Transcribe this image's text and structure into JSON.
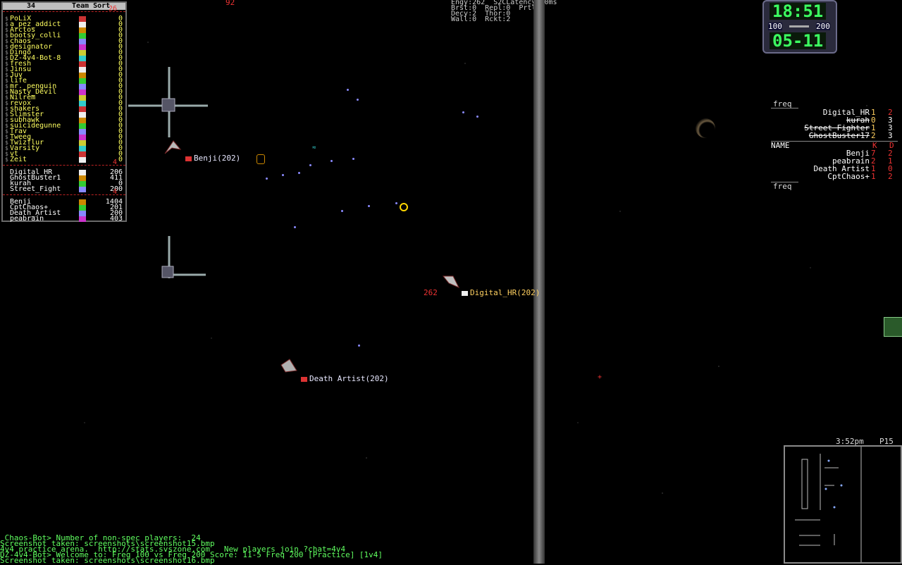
{
  "roster": {
    "count": "34",
    "title": "Team Sort",
    "groups": [
      {
        "count": "26",
        "players": [
          {
            "name": "PoLiX",
            "score": "0"
          },
          {
            "name": "a_pez_addict",
            "score": "0"
          },
          {
            "name": "Arctos",
            "score": "0"
          },
          {
            "name": "bootsy_colli",
            "score": "0"
          },
          {
            "name": "chaos",
            "score": "0"
          },
          {
            "name": "designator",
            "score": "0"
          },
          {
            "name": "Dingo",
            "score": "0"
          },
          {
            "name": "DZ-4v4-Bot-8",
            "score": "0"
          },
          {
            "name": "fresh",
            "score": "0"
          },
          {
            "name": "Jinsu",
            "score": "0"
          },
          {
            "name": "Juv",
            "score": "0"
          },
          {
            "name": "life",
            "score": "0"
          },
          {
            "name": "mr._penguin",
            "score": "0"
          },
          {
            "name": "Nasty_Devil",
            "score": "0"
          },
          {
            "name": "Nilrem",
            "score": "0"
          },
          {
            "name": "revox",
            "score": "0"
          },
          {
            "name": "shakers",
            "score": "0"
          },
          {
            "name": "Slimster",
            "score": "0"
          },
          {
            "name": "subhawk",
            "score": "0"
          },
          {
            "name": "suicidegunne",
            "score": "0"
          },
          {
            "name": "Trav",
            "score": "0"
          },
          {
            "name": "Tweeg",
            "score": "0"
          },
          {
            "name": "Twizflur",
            "score": "0"
          },
          {
            "name": "Varsity",
            "score": "0"
          },
          {
            "name": "vt",
            "score": "0"
          },
          {
            "name": "Zeit",
            "score": "0"
          }
        ]
      },
      {
        "count": "4",
        "players": [
          {
            "name": "Digital_HR",
            "score": "206"
          },
          {
            "name": "GhostBuster1",
            "score": "411"
          },
          {
            "name": "kurah",
            "score": "0"
          },
          {
            "name": "Street_Fight",
            "score": "200"
          }
        ]
      },
      {
        "count": "4",
        "players": [
          {
            "name": "Benji",
            "score": "1404"
          },
          {
            "name": "CptChaos+",
            "score": "201"
          },
          {
            "name": "Death_Artist",
            "score": "200"
          },
          {
            "name": "peabrain",
            "score": "403"
          }
        ]
      }
    ]
  },
  "hud": {
    "energy_indicator": "92",
    "stats_line1": "Engy:262  S2CLatency:80ms",
    "stats_line2": "Brst:0  Repl:0  Prtl:2",
    "stats_line3": "Decy:2  Thor:0",
    "stats_line4": "Wall:0  Rckt:2",
    "clock_top": "18:51",
    "freq_left": "100",
    "freq_right": "200",
    "clock_bottom": "05-11",
    "time": "3:52pm",
    "page": "P15"
  },
  "ships": [
    {
      "label": "Benji(202)"
    },
    {
      "label": "Digital_HR(202)",
      "energy": "262"
    },
    {
      "label": "Death Artist(202)"
    }
  ],
  "freq_table": {
    "header": "freq",
    "rows": [
      {
        "name": "Digital_HR",
        "k": "1",
        "d": "2"
      },
      {
        "name": "kurah",
        "k": "0",
        "d": "3"
      },
      {
        "name": "Street Fighter",
        "k": "1",
        "d": "3"
      },
      {
        "name": "GhostBuster17",
        "k": "2",
        "d": "3"
      }
    ]
  },
  "name_table": {
    "col_name": "NAME",
    "col_k": "K",
    "col_d": "D",
    "rows": [
      {
        "name": "Benji",
        "k": "7",
        "d": "2"
      },
      {
        "name": "peabrain",
        "k": "2",
        "d": "1"
      },
      {
        "name": "Death Artist",
        "k": "1",
        "d": "0"
      },
      {
        "name": "CptChaos+",
        "k": "1",
        "d": "2"
      }
    ],
    "footer": "freq"
  },
  "chat": [
    {
      "text": " Chaos-Bot> Number of non-spec players:  24",
      "color": "#60ff60"
    },
    {
      "text": "Screenshot taken: screenshots\\screenshot15.bmp",
      "color": "#60ff60"
    },
    {
      "text": "4v4 practice arena.  http://stats.svszone.com   New players join ?chat=4v4",
      "color": "#60ff60"
    },
    {
      "text": "DZ-4v4-Bot> Welcome to: Freq 100 vs Freq 200 Score: 11-5 Freq 200 [Practice] [1v4]",
      "color": "#60ff60"
    },
    {
      "text": "Screenshot taken: screenshots\\screenshot16.bmp",
      "color": "#60ff60"
    }
  ],
  "colors": {
    "roster_name": "#ffff60",
    "chat": "#60ff60",
    "accent_red": "#e33333"
  }
}
